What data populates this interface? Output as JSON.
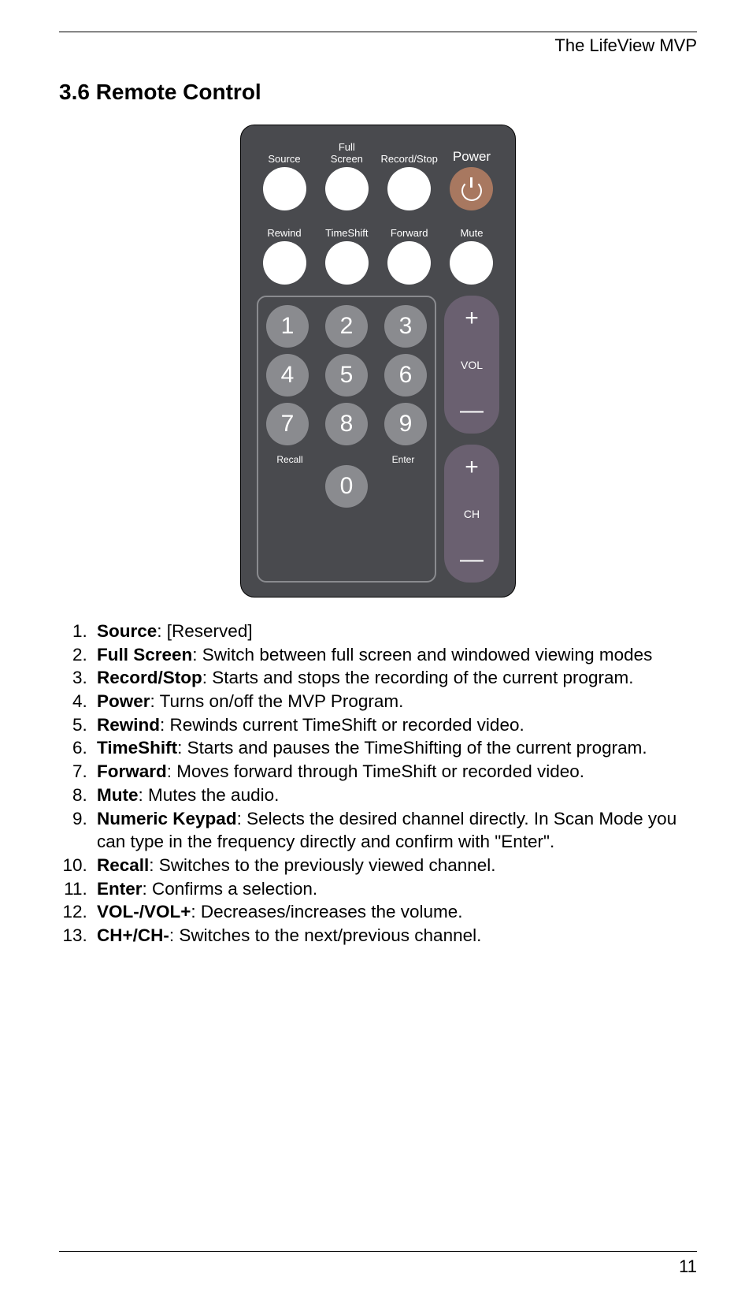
{
  "header": "The LifeView MVP",
  "section_title": "3.6 Remote Control",
  "remote": {
    "row1": [
      {
        "label": "Source"
      },
      {
        "label": "Full\nScreen"
      },
      {
        "label": "Record/Stop"
      },
      {
        "label": "Power",
        "power": true
      }
    ],
    "row2": [
      {
        "label": "Rewind"
      },
      {
        "label": "TimeShift"
      },
      {
        "label": "Forward"
      },
      {
        "label": "Mute"
      }
    ],
    "keypad": {
      "r1": [
        "1",
        "2",
        "3"
      ],
      "r2": [
        "4",
        "5",
        "6"
      ],
      "r3": [
        "7",
        "8",
        "9"
      ],
      "recall_label": "Recall",
      "zero": "0",
      "enter_label": "Enter"
    },
    "vol": {
      "plus": "+",
      "label": "VOL",
      "minus": "—"
    },
    "ch": {
      "plus": "+",
      "label": "CH",
      "minus": "—"
    }
  },
  "descriptions": [
    {
      "term": "Source",
      "text": ": [Reserved]"
    },
    {
      "term": "Full Screen",
      "text": ": Switch between full screen and windowed viewing modes"
    },
    {
      "term": "Record/Stop",
      "text": ": Starts and stops the recording of the current program."
    },
    {
      "term": "Power",
      "text": ": Turns on/off the MVP Program."
    },
    {
      "term": "Rewind",
      "text": ": Rewinds current TimeShift or recorded video."
    },
    {
      "term": "TimeShift",
      "text": ": Starts and pauses the TimeShifting of the current program."
    },
    {
      "term": "Forward",
      "text": ": Moves forward through TimeShift or recorded video."
    },
    {
      "term": "Mute",
      "text": ": Mutes the audio."
    },
    {
      "term": "Numeric Keypad",
      "text": ": Selects the desired channel directly. In Scan Mode you can type in the frequency directly and confirm with \"Enter\"."
    },
    {
      "term": "Recall",
      "text": ": Switches to the previously viewed channel."
    },
    {
      "term": "Enter",
      "text": ": Confirms a selection."
    },
    {
      "term": "VOL-/VOL+",
      "text": ": Decreases/increases the volume."
    },
    {
      "term": "CH+/CH-",
      "text": ": Switches to the next/previous channel."
    }
  ],
  "page_number": "11"
}
